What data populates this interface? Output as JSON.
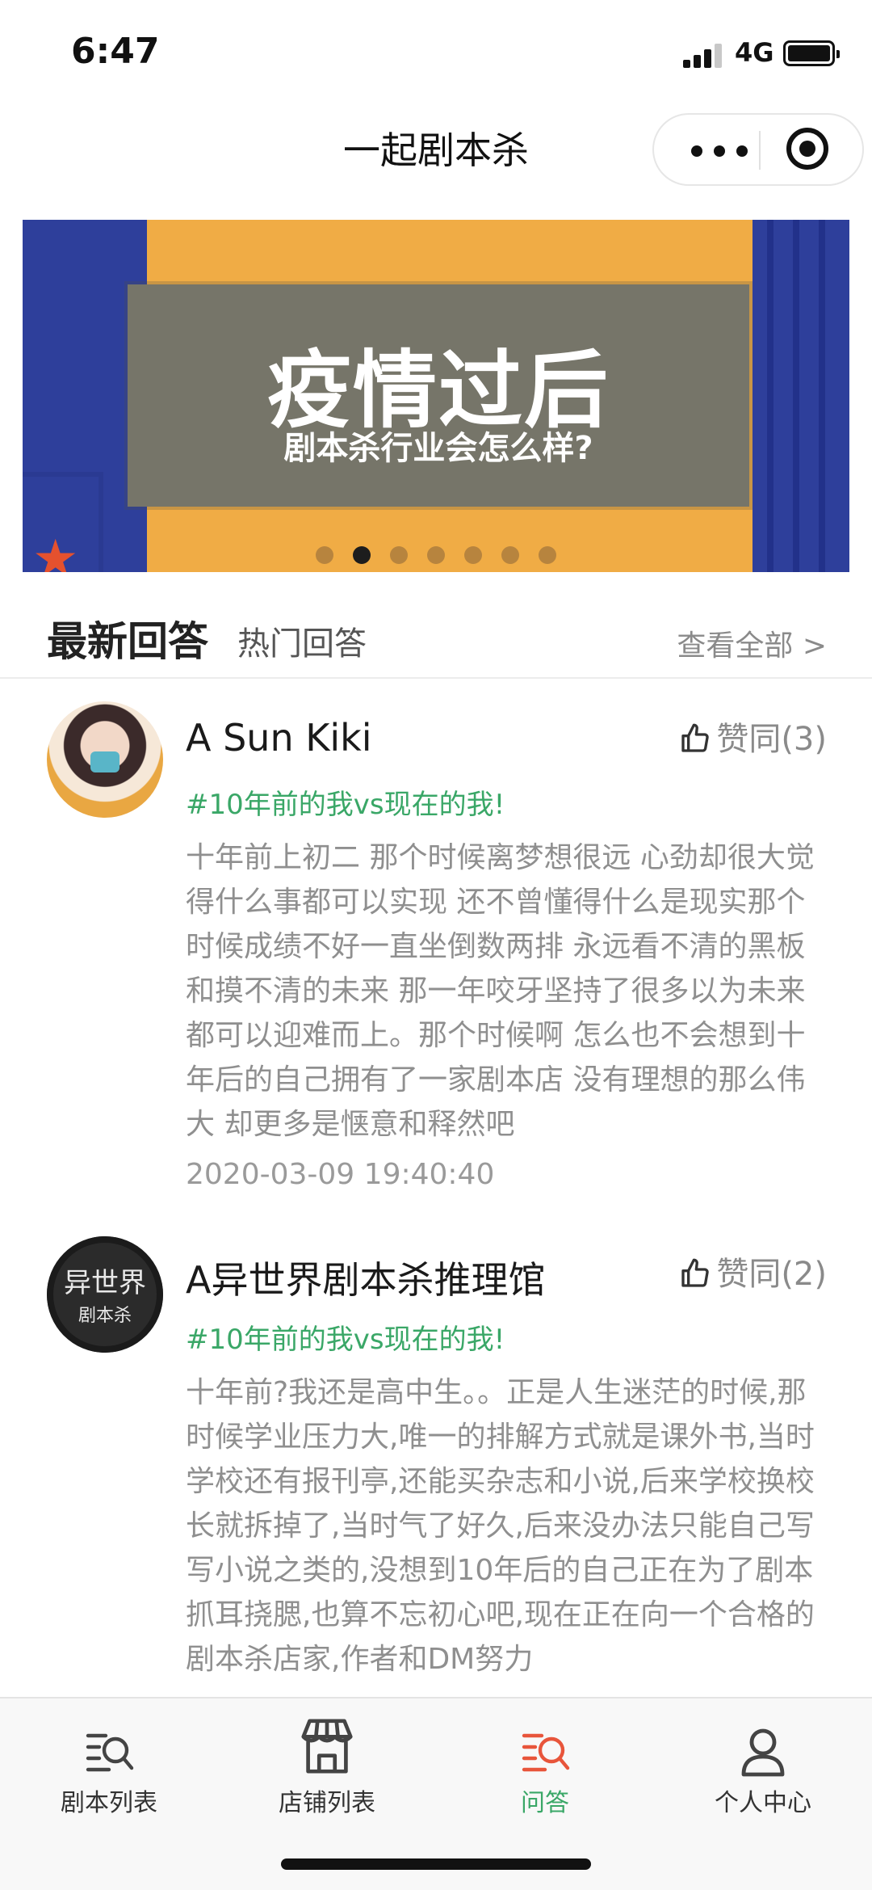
{
  "status_bar": {
    "time": "6:47",
    "network": "4G"
  },
  "nav": {
    "title": "一起剧本杀"
  },
  "banner": {
    "headline": "疫情过后",
    "subline": "剧本杀行业会怎么样?",
    "slide_count": 7,
    "active_slide": 2,
    "colors": {
      "blue": "#2e3f9b",
      "orange": "#f0ac45",
      "panel": "#767569"
    }
  },
  "section": {
    "tab_latest": "最新回答",
    "tab_hot": "热门回答",
    "view_all": "查看全部 >"
  },
  "posts": [
    {
      "author": "A Sun Kiki",
      "like_label": "赞同(3)",
      "topic": "#10年前的我vs现在的我!",
      "content": "十年前上初二 那个时候离梦想很远 心劲却很大觉得什么事都可以实现 还不曾懂得什么是现实那个时候成绩不好一直坐倒数两排 永远看不清的黑板和摸不清的未来 那一年咬牙坚持了很多以为未来都可以迎难而上。那个时候啊 怎么也不会想到十年后的自己拥有了一家剧本店 没有理想的那么伟大 却更多是惬意和释然吧",
      "date": "2020-03-09 19:40:40"
    },
    {
      "author": "A异世界剧本杀推理馆",
      "avatar_text": [
        "异世界",
        "剧本杀"
      ],
      "like_label": "赞同(2)",
      "topic": "#10年前的我vs现在的我!",
      "content": "十年前?我还是高中生。。正是人生迷茫的时候,那时候学业压力大,唯一的排解方式就是课外书,当时学校还有报刊亭,还能买杂志和小说,后来学校换校长就拆掉了,当时气了好久,后来没办法只能自己写写小说之类的,没想到10年后的自己正在为了剧本抓耳挠腮,也算不忘初心吧,现在正在向一个合格的剧本杀店家,作者和DM努力"
    }
  ],
  "tabbar": {
    "items": [
      {
        "label": "剧本列表",
        "icon": "script-list-icon"
      },
      {
        "label": "店铺列表",
        "icon": "store-icon"
      },
      {
        "label": "问答",
        "icon": "qa-icon",
        "active": true
      },
      {
        "label": "个人中心",
        "icon": "person-icon"
      }
    ],
    "active_color": "#3aa767",
    "active_icon_color": "#e8553b"
  }
}
